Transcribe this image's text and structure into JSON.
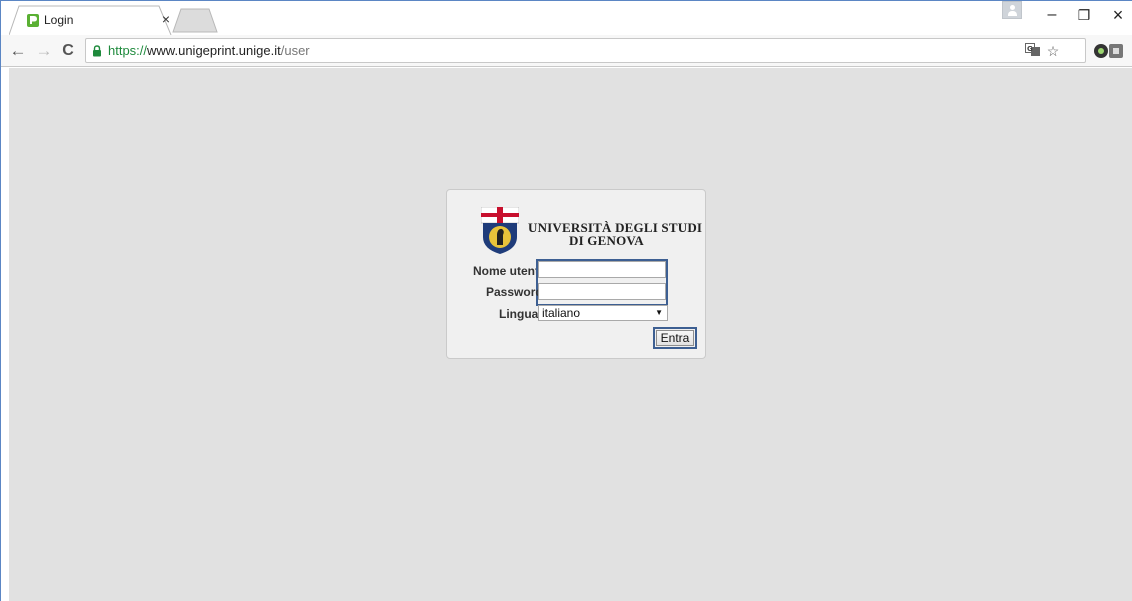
{
  "tab": {
    "title": "Login",
    "close": "×"
  },
  "window_controls": {
    "minimize": "–",
    "restore": "❐",
    "close": "×"
  },
  "address_bar": {
    "scheme": "https://",
    "host": "www.unigeprint.unige.it",
    "path": "/user"
  },
  "logo": {
    "line1": "UNIVERSITÀ DEGLI STUDI",
    "line2": "DI GENOVA"
  },
  "form": {
    "username_label": "Nome utente",
    "username_value": "",
    "password_label": "Password",
    "password_value": "",
    "language_label": "Lingua",
    "language_selected": "italiano",
    "submit_label": "Entra"
  },
  "colors": {
    "page_background": "#e1e1e1",
    "login_box": "#f0f0f0",
    "focus_border": "#3d5f92",
    "secure_green": "#1e8a3c"
  },
  "icons": [
    "back-arrow-icon",
    "forward-arrow-icon",
    "reload-icon",
    "lock-icon",
    "translate-icon",
    "star-icon",
    "extension-icon",
    "menu-dots-icon",
    "profile-icon"
  ]
}
